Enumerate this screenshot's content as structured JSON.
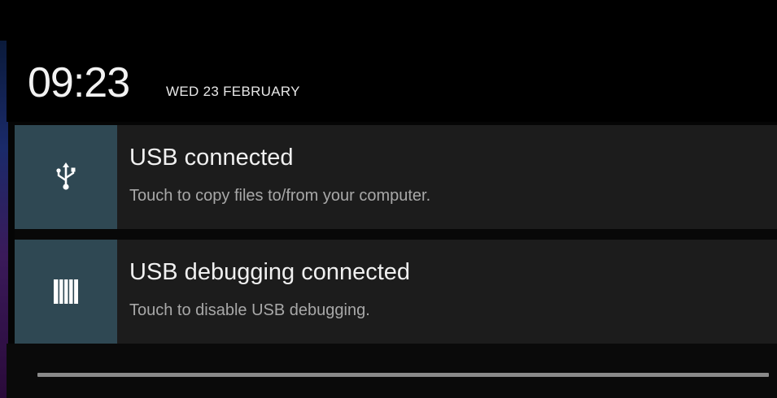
{
  "header": {
    "time": "09:23",
    "date": "WED 23 FEBRUARY"
  },
  "notifications": [
    {
      "icon": "usb-icon",
      "title": "USB connected",
      "subtitle": "Touch to copy files to/from your computer."
    },
    {
      "icon": "usb-debugging-icon",
      "title": "USB debugging connected",
      "subtitle": "Touch to disable USB debugging."
    }
  ],
  "colors": {
    "background": "#000000",
    "notification_background": "#1c1c1c",
    "icon_box": "#2f4853",
    "title_text": "#f0f0f0",
    "subtitle_text": "#a8a8a8",
    "handle": "#8a8a8a"
  }
}
